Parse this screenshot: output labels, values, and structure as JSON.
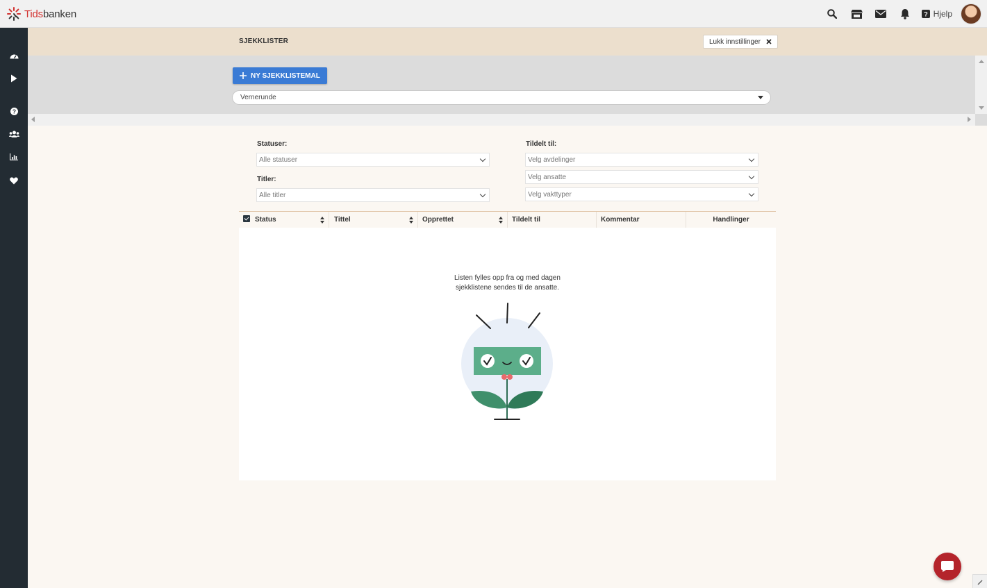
{
  "app": {
    "logo_prefix": "Tids",
    "logo_suffix": "banken",
    "help_label": "Hjelp"
  },
  "top_icons": [
    "search-icon",
    "store-icon",
    "mail-icon",
    "bell-icon",
    "help-icon"
  ],
  "sidebar": {
    "items": [
      "dashboard-icon",
      "play-icon",
      "question-icon",
      "users-icon",
      "chart-icon",
      "heart-icon"
    ]
  },
  "settings": {
    "title": "SJEKKLISTER",
    "close_label": "Lukk innstillinger",
    "new_button_label": "NY SJEKKLISTEMAL",
    "template_selected": "Vernerunde"
  },
  "filters": {
    "status_label": "Statuser:",
    "status_value": "Alle statuser",
    "titles_label": "Titler:",
    "titles_value": "Alle titler",
    "assigned_label": "Tildelt til:",
    "departments_value": "Velg avdelinger",
    "employees_value": "Velg ansatte",
    "shift_types_value": "Velg vakttyper"
  },
  "table": {
    "columns": [
      "Status",
      "Tittel",
      "Opprettet",
      "Tildelt til",
      "Kommentar",
      "Handlinger"
    ],
    "empty_line1": "Listen fylles opp fra og med dagen",
    "empty_line2": "sjekklistene sendes til de ansatte."
  },
  "colors": {
    "accent_blue": "#3a7bd5",
    "sidebar": "#232c33",
    "brand_red": "#d2312f",
    "settings_bar": "#ecdfcd"
  }
}
